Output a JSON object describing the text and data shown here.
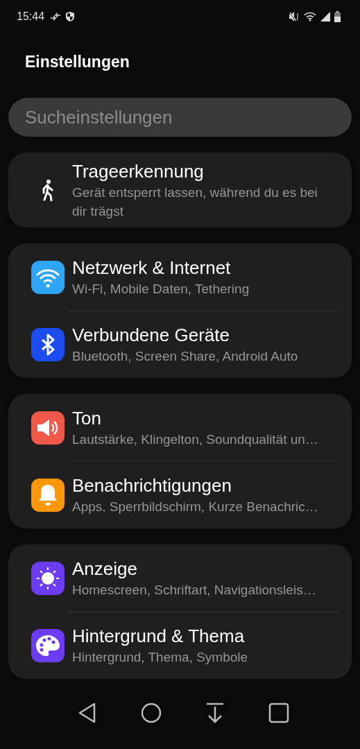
{
  "status_bar": {
    "time": "15:44"
  },
  "title": "Einstellungen",
  "search": {
    "placeholder": "Sucheinstellungen"
  },
  "groups": [
    {
      "items": [
        {
          "kind": "walk",
          "title": "Trageerkennung",
          "subtitle": "Gerät entsperrt lassen, während du es bei dir trägst"
        }
      ]
    },
    {
      "items": [
        {
          "kind": "wifi",
          "color": "#2ea6f5",
          "title": "Netzwerk & Internet",
          "subtitle": "Wi-Fi, Mobile Daten, Tethering"
        },
        {
          "kind": "bluetooth",
          "color": "#1c4cf0",
          "title": "Verbundene Geräte",
          "subtitle": "Bluetooth, Screen Share, Android Auto"
        }
      ]
    },
    {
      "items": [
        {
          "kind": "sound",
          "color": "#f0584a",
          "title": "Ton",
          "subtitle": "Lautstärke, Klingelton, Soundqualität un…"
        },
        {
          "kind": "bell",
          "color": "#fb9708",
          "title": "Benachrichtigungen",
          "subtitle": "Apps, Sperrbildschirm, Kurze Benachric…"
        }
      ]
    },
    {
      "items": [
        {
          "kind": "sun",
          "color": "#6b3cf2",
          "title": "Anzeige",
          "subtitle": "Homescreen, Schriftart, Navigationsleis…"
        },
        {
          "kind": "palette",
          "color": "#6b3cf2",
          "title": "Hintergrund & Thema",
          "subtitle": "Hintergrund, Thema, Symbole"
        }
      ]
    }
  ]
}
